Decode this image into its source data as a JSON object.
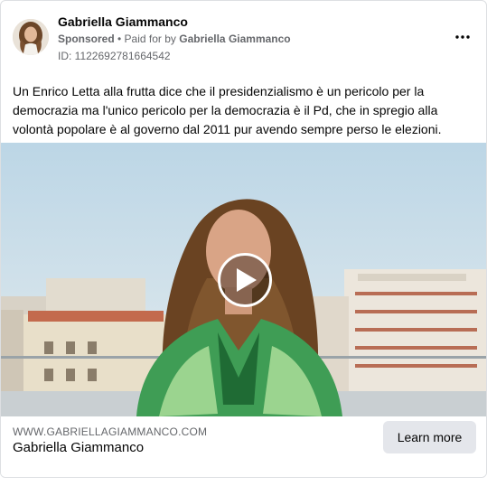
{
  "ad": {
    "page_name": "Gabriella Giammanco",
    "sponsored_label": "Sponsored",
    "separator": " • ",
    "paid_for_prefix": "Paid for by ",
    "payer": "Gabriella Giammanco",
    "ad_id": "ID: 1122692781664542",
    "more_icon": "three-dots-icon",
    "body": "Un Enrico Letta alla frutta dice che il presidenzialismo è un pericolo per la democrazia ma l'unico pericolo per la democrazia è il Pd, che in spregio alla volontà popolare è al governo dal 2011 pur avendo sempre perso le elezioni.",
    "media": {
      "type": "video",
      "play_icon": "play-icon"
    },
    "footer": {
      "domain": "WWW.GABRIELLAGIAMMANCO.COM",
      "headline": "Gabriella Giammanco",
      "cta_label": "Learn more"
    }
  },
  "colors": {
    "secondary_text": "#65676b",
    "primary_text": "#050505",
    "button_bg": "#e4e6eb",
    "border": "#dddfe2"
  }
}
